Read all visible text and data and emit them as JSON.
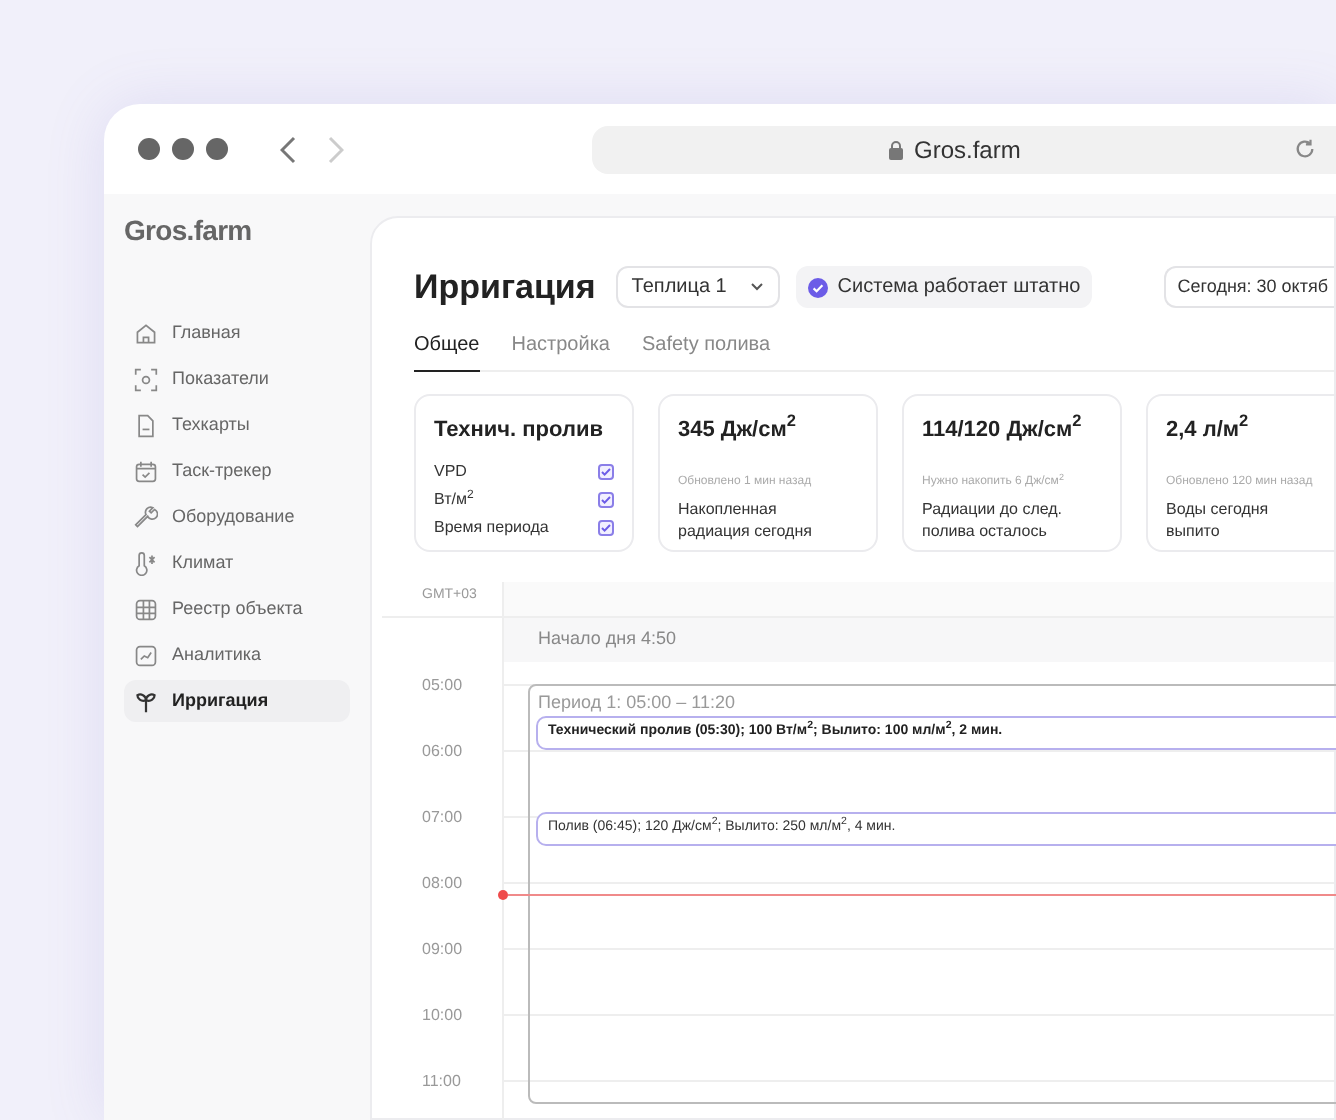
{
  "browser": {
    "address": "Gros.farm"
  },
  "sidebar": {
    "logo": "Gros.farm",
    "items": [
      {
        "label": "Главная",
        "selected": false
      },
      {
        "label": "Показатели",
        "selected": false
      },
      {
        "label": "Техкарты",
        "selected": false
      },
      {
        "label": "Таск-трекер",
        "selected": false
      },
      {
        "label": "Оборудование",
        "selected": false
      },
      {
        "label": "Климат",
        "selected": false
      },
      {
        "label": "Реестр объекта",
        "selected": false
      },
      {
        "label": "Аналитика",
        "selected": false
      },
      {
        "label": "Ирригация",
        "selected": true
      }
    ]
  },
  "header": {
    "title": "Ирригация",
    "greenhouse": "Теплица 1",
    "status": "Система работает штатно",
    "date": "Сегодня: 30 октяб"
  },
  "tabs": [
    {
      "label": "Общее",
      "selected": true
    },
    {
      "label": "Настройка",
      "selected": false
    },
    {
      "label": "Safety полива",
      "selected": false
    }
  ],
  "cards": [
    {
      "kind": "checklist",
      "title": "Технич. пролив",
      "items": [
        {
          "label": "VPD",
          "checked": true
        },
        {
          "label": "Вт/м$^{2}$",
          "checked": true
        },
        {
          "label": "Время периода",
          "checked": true
        }
      ]
    },
    {
      "kind": "stat",
      "value": "345 Дж/см$^{2}$",
      "note": "Обновлено 1 мин назад",
      "caption": "Накопленная радиация сегодня"
    },
    {
      "kind": "stat",
      "value": "114/120 Дж/см$^{2}$",
      "note": "Нужно накопить 6 Дж/см$^{2}$",
      "caption": "Радиации до след. полива осталось"
    },
    {
      "kind": "stat",
      "value": "2,4 л/м$^{2}$",
      "note": "Обновлено 120 мин назад",
      "caption": "Воды сегодня выпито"
    }
  ],
  "timeline": {
    "timezone": "GMT+03",
    "day_start": "Начало дня 4:50",
    "hours": [
      "05:00",
      "06:00",
      "07:00",
      "08:00",
      "09:00",
      "10:00",
      "11:00"
    ],
    "period": "Период 1: 05:00 – 11:20",
    "events": [
      {
        "text": "Технический пролив (05:30); 100 Вт/м$^{2}$; Вылито: 100 мл/м$^{2}$, 2 мин.",
        "emphasis": true
      },
      {
        "text": "Полив (06:45); 120 Дж/см$^{2}$; Вылито: 250 мл/м$^{2}$, 4 мин.",
        "emphasis": false
      }
    ]
  }
}
